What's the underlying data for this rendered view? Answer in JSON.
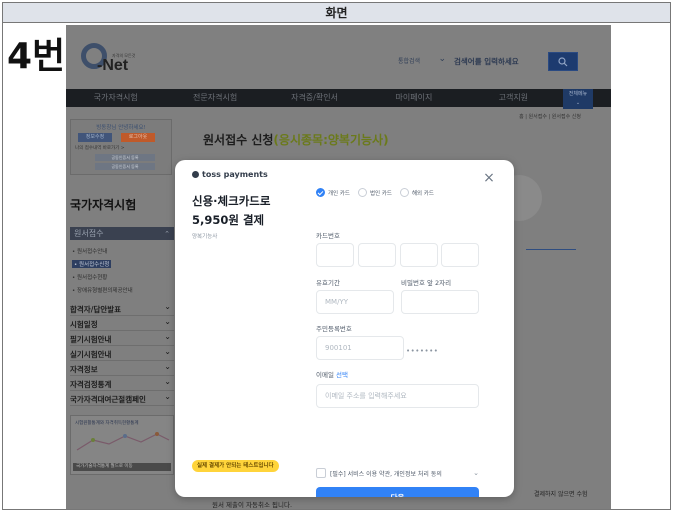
{
  "doc": {
    "header": "화면",
    "step": "4번"
  },
  "site": {
    "logo_small": "자격의 모든것",
    "logo_text": "-Net",
    "search_scope": "통합검색",
    "search_placeholder": "검색어를 입력하세요",
    "nav": [
      "국가자격시험",
      "전문자격시험",
      "자격증/확인서",
      "마이페이지",
      "고객지원"
    ],
    "nav_all": "전체메뉴",
    "breadcrumb": "홈 | 원서접수 | 원서접수 신청",
    "page_title_main": "원서접수 신청",
    "page_title_hl": "(응시종목:양복기능사)",
    "sidebar": {
      "login_title": "빙동창님 안녕하세요!",
      "btn_info": "정보수정",
      "btn_logout": "로그아웃",
      "login_note": "나의 접수내역 바로가기 >",
      "mini1": "공동인증서 등록",
      "mini2": "공동인증서 등록",
      "heading": "국가자격시험",
      "menu_head": "원서접수",
      "subs": [
        "• 원서접수안내",
        "• 원서접수신청",
        "• 원서접수현황",
        "• 장애유형별편의제공안내"
      ],
      "items": [
        "합격자/답안발표",
        "시험일정",
        "필기시험안내",
        "실기시험안내",
        "자격정보",
        "자격검정통계",
        "국가자격대여근절캠페인"
      ],
      "banner_title": "시험원활통계와 자격취득현황통계",
      "banner_bar": "국가기술자격통계 월드로 이동"
    },
    "bottom_text": "원서 제출이 자동취소 됩니다.",
    "bottom_right": "결제하지 않으면 수험"
  },
  "modal": {
    "brand": "toss payments",
    "line1": "신용·체크카드로",
    "line2": "5,950원 결제",
    "product": "양복기능사",
    "card_types": [
      {
        "label": "개인 카드",
        "checked": true
      },
      {
        "label": "법인 카드",
        "checked": false
      },
      {
        "label": "해외 카드",
        "checked": false
      }
    ],
    "card_number_label": "카드번호",
    "expiry_label": "유효기간",
    "expiry_placeholder": "MM/YY",
    "pin_label": "비밀번호 앞 2자리",
    "rrn_label": "주민등록번호",
    "rrn_value": "900101",
    "rrn_masked": "•••••••",
    "email_label": "이메일",
    "email_optional": "선택",
    "email_placeholder": "이메일 주소를 입력해주세요",
    "agree_text": "[필수] 서비스 이용 약관, 개인정보 처리 동의",
    "next_label": "다음",
    "test_badge": "실제 결제가 안되는 테스트입니다"
  }
}
